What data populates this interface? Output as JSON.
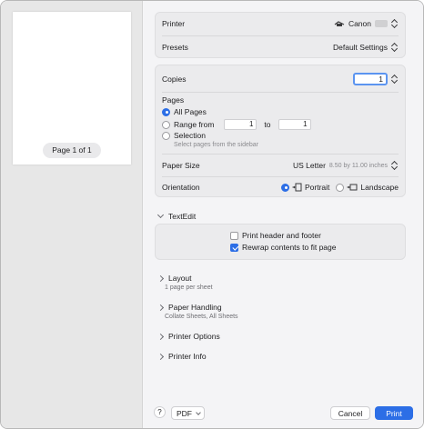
{
  "preview": {
    "page_counter": "Page 1 of 1"
  },
  "printer": {
    "label": "Printer",
    "value": "Canon"
  },
  "presets": {
    "label": "Presets",
    "value": "Default Settings"
  },
  "copies": {
    "label": "Copies",
    "value": "1"
  },
  "pages": {
    "label": "Pages",
    "all_pages": "All Pages",
    "range_from": "Range from",
    "range_start": "1",
    "range_to": "to",
    "range_end": "1",
    "selection": "Selection",
    "selection_hint": "Select pages from the sidebar"
  },
  "paper_size": {
    "label": "Paper Size",
    "value": "US Letter",
    "detail": "8.50 by 11.00 inches"
  },
  "orientation": {
    "label": "Orientation",
    "portrait": "Portrait",
    "landscape": "Landscape"
  },
  "textedit": {
    "label": "TextEdit",
    "print_header": "Print header and footer",
    "rewrap": "Rewrap contents to fit page"
  },
  "sections": {
    "layout": {
      "label": "Layout",
      "sub": "1 page per sheet"
    },
    "paper_handling": {
      "label": "Paper Handling",
      "sub": "Collate Sheets, All Sheets"
    },
    "printer_options": {
      "label": "Printer Options"
    },
    "printer_info": {
      "label": "Printer Info"
    }
  },
  "footer": {
    "help": "?",
    "pdf": "PDF",
    "cancel": "Cancel",
    "print": "Print"
  },
  "colors": {
    "accent": "#2c6ee6"
  }
}
